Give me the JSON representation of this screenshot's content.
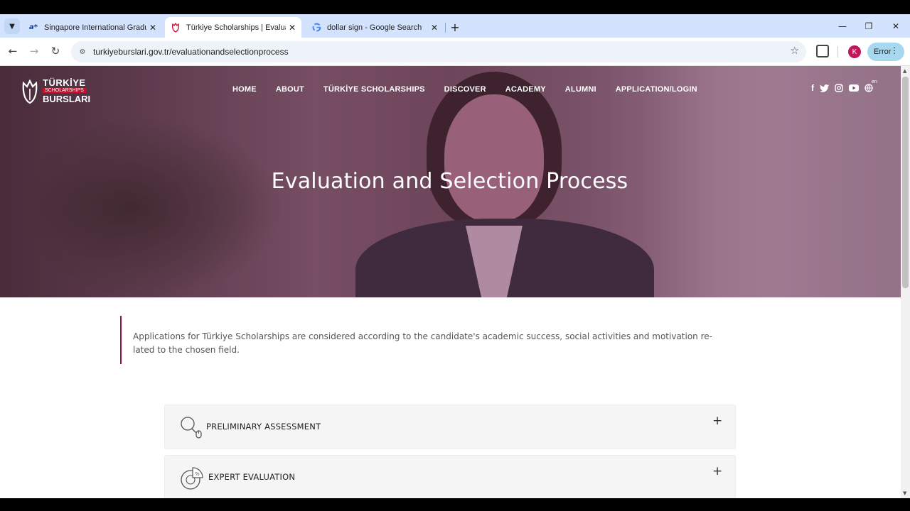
{
  "browser": {
    "tabs": [
      {
        "title": "Singapore International Gradua",
        "favicon": "a-star-icon"
      },
      {
        "title": "Türkiye Scholarships | Evaluatio",
        "favicon": "tulip-icon"
      },
      {
        "title": "dollar sign - Google Search",
        "favicon": "google-g-icon"
      }
    ],
    "active_tab_index": 1,
    "url": "turkiyeburslari.gov.tr/evaluationandselectionprocess",
    "profile_initial": "K",
    "error_label": "Error"
  },
  "site": {
    "logo": {
      "line1": "TÜRKİYE",
      "line2": "SCHOLARSHIPS",
      "line3": "BURSLARI"
    },
    "nav": [
      "HOME",
      "ABOUT",
      "TÜRKİYE SCHOLARSHIPS",
      "DISCOVER",
      "ACADEMY",
      "ALUMNI",
      "APPLICATION/LOGIN"
    ],
    "social": [
      "f",
      "t",
      "◎",
      "▶",
      "🌐"
    ],
    "language_code": "en",
    "hero_title": "Evaluation and Selection Process"
  },
  "content": {
    "intro_line1": "Applications for Türkiye Scholarships are considered according to the candidate's academic success, social activities and motivation re-",
    "intro_line2": "lated to the chosen field.",
    "accordion": [
      {
        "label": "PRELIMINARY ASSESSMENT",
        "icon": "magnifier-mouse-icon"
      },
      {
        "label": "EXPERT EVALUATION",
        "icon": "percent-pie-icon"
      }
    ]
  },
  "colors": {
    "accent": "#8b1a3a",
    "tabstrip": "#d3e3fd",
    "error_pill": "#a8d8f0"
  }
}
